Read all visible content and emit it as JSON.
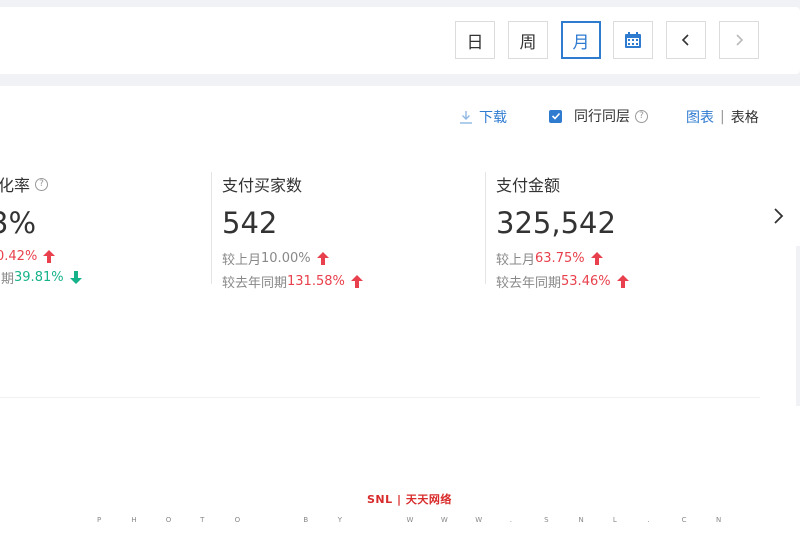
{
  "period": {
    "day": "日",
    "week": "周",
    "month": "月",
    "active": "月"
  },
  "toolbar": {
    "download": "下载",
    "same_industry": "同行同层",
    "same_industry_checked": true,
    "view_chart": "图表",
    "view_separator": "|",
    "view_table": "表格"
  },
  "metrics": [
    {
      "label": "化率",
      "value": "3%",
      "cmp1_prefix": "",
      "cmp1_value": "0.42%",
      "cmp1_dir": "up",
      "cmp2_prefix": "同期",
      "cmp2_value": "39.81%",
      "cmp2_dir": "down"
    },
    {
      "label": "支付买家数",
      "value": "542",
      "cmp1_prefix": "较上月",
      "cmp1_value": "10.00%",
      "cmp1_dir": "up",
      "cmp2_prefix": "较去年同期",
      "cmp2_value": "131.58%",
      "cmp2_dir": "up"
    },
    {
      "label": "支付金额",
      "value": "325,542",
      "cmp1_prefix": "较上月",
      "cmp1_value": "63.75%",
      "cmp1_dir": "up",
      "cmp2_prefix": "较去年同期",
      "cmp2_value": "53.46%",
      "cmp2_dir": "up"
    }
  ],
  "watermark": {
    "logo": "SNL | 天天网络",
    "text": [
      "P",
      "H",
      "O",
      "T",
      "O",
      "",
      "B",
      "Y",
      "",
      "W",
      "W",
      "W",
      ".",
      "S",
      "N",
      "L",
      ".",
      "C",
      "N"
    ]
  },
  "colors": {
    "accent": "#2f7bd0",
    "up": "#e8414d",
    "down": "#16b38a"
  }
}
